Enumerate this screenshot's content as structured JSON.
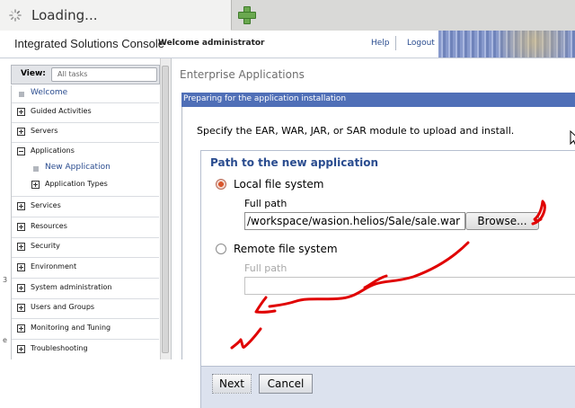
{
  "browser": {
    "tab_title": "Loading...",
    "spinner_icon": "loading-spinner-icon",
    "new_tab_icon": "plus-icon"
  },
  "header": {
    "brand": "Integrated Solutions Console",
    "welcome": "Welcome administrator",
    "help": "Help",
    "logout": "Logout"
  },
  "nav": {
    "view_label": "View:",
    "view_select": "All tasks",
    "items": [
      {
        "label": "Welcome",
        "kind": "link"
      },
      {
        "label": "Guided Activities",
        "kind": "collapsed"
      },
      {
        "label": "Servers",
        "kind": "collapsed"
      },
      {
        "label": "Applications",
        "kind": "expanded"
      },
      {
        "label": "New Application",
        "kind": "child-link"
      },
      {
        "label": "Application Types",
        "kind": "child-collapsed"
      },
      {
        "label": "Services",
        "kind": "collapsed"
      },
      {
        "label": "Resources",
        "kind": "collapsed"
      },
      {
        "label": "Security",
        "kind": "collapsed"
      },
      {
        "label": "Environment",
        "kind": "collapsed"
      },
      {
        "label": "System administration",
        "kind": "collapsed"
      },
      {
        "label": "Users and Groups",
        "kind": "collapsed"
      },
      {
        "label": "Monitoring and Tuning",
        "kind": "collapsed"
      },
      {
        "label": "Troubleshooting",
        "kind": "collapsed"
      }
    ],
    "edge_chars": [
      "3",
      "e"
    ]
  },
  "main": {
    "breadcrumb": "Enterprise Applications",
    "panel_title": "Preparing for the application installation",
    "description": "Specify the EAR, WAR, JAR, or SAR module to upload and install.",
    "group_title": "Path to the new application",
    "local": {
      "label": "Local file system",
      "full_path_label": "Full path",
      "full_path_value": "/workspace/wasion.helios/Sale/sale.war",
      "browse_label": "Browse...",
      "selected": true
    },
    "remote": {
      "label": "Remote file system",
      "full_path_label": "Full path",
      "full_path_value": "",
      "selected": false
    },
    "buttons": {
      "next": "Next",
      "cancel": "Cancel"
    }
  },
  "annotation": {
    "color": "#e00000"
  }
}
